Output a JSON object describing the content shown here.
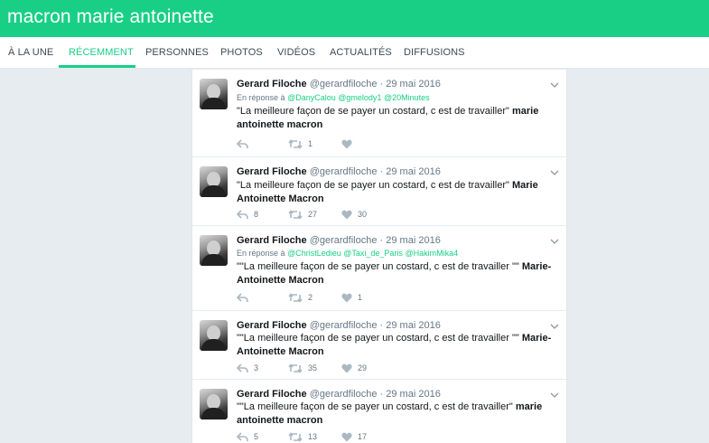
{
  "search": {
    "query": "macron marie antoinette"
  },
  "tabs": [
    {
      "label": "À LA UNE"
    },
    {
      "label": "RÉCEMMENT"
    },
    {
      "label": "PERSONNES"
    },
    {
      "label": "PHOTOS"
    },
    {
      "label": "VIDÉOS"
    },
    {
      "label": "ACTUALITÉS"
    },
    {
      "label": "DIFFUSIONS"
    }
  ],
  "colors": {
    "brand": "#19cf86",
    "muted": "#657786",
    "background": "#e6ecf0"
  },
  "tweets": [
    {
      "name": "Gerard Filoche",
      "handle": "@gerardfiloche",
      "separator": "·",
      "date": "29 mai 2016",
      "reply_prefix": "En réponse à",
      "reply_mentions": [
        "@DanyCalou",
        "@gmelody1",
        "@20Minutes"
      ],
      "text_plain": "\"La meilleure façon de se payer un costard, c est de travailler\" ",
      "text_bold": "marie antoinette macron",
      "reply_count": "",
      "retweet_count": "1",
      "like_count": ""
    },
    {
      "name": "Gerard Filoche",
      "handle": "@gerardfiloche",
      "separator": "·",
      "date": "29 mai 2016",
      "text_plain": "\"La meilleure façon de se payer un costard, c est de travailler\"   ",
      "text_bold": "Marie Antoinette Macron",
      "reply_count": "8",
      "retweet_count": "27",
      "like_count": "30"
    },
    {
      "name": "Gerard Filoche",
      "handle": "@gerardfiloche",
      "separator": "·",
      "date": "29 mai 2016",
      "reply_prefix": "En réponse à",
      "reply_mentions": [
        "@ChristLedieu",
        "@Taxi_de_Paris",
        "@HakimMika4"
      ],
      "text_plain": "\"\"La meilleure façon de se payer un costard, c est de travailler \"\" ",
      "text_bold": "Marie-Antoinette Macron",
      "reply_count": "",
      "retweet_count": "2",
      "like_count": "1"
    },
    {
      "name": "Gerard Filoche",
      "handle": "@gerardfiloche",
      "separator": "·",
      "date": "29 mai 2016",
      "text_plain": "\"\"La meilleure façon de se payer un costard, c est de travailler \"\" ",
      "text_bold": "Marie-Antoinette Macron",
      "reply_count": "3",
      "retweet_count": "35",
      "like_count": "29"
    },
    {
      "name": "Gerard Filoche",
      "handle": "@gerardfiloche",
      "separator": "·",
      "date": "29 mai 2016",
      "text_plain": "\"\"La meilleure façon de se payer un costard, c est de travailler\" ",
      "text_bold": "marie antoinette macron",
      "reply_count": "5",
      "retweet_count": "13",
      "like_count": "17"
    }
  ],
  "icons": {
    "reply": "reply-icon",
    "retweet": "retweet-icon",
    "like": "heart-icon",
    "caret": "chevron-down-icon"
  }
}
